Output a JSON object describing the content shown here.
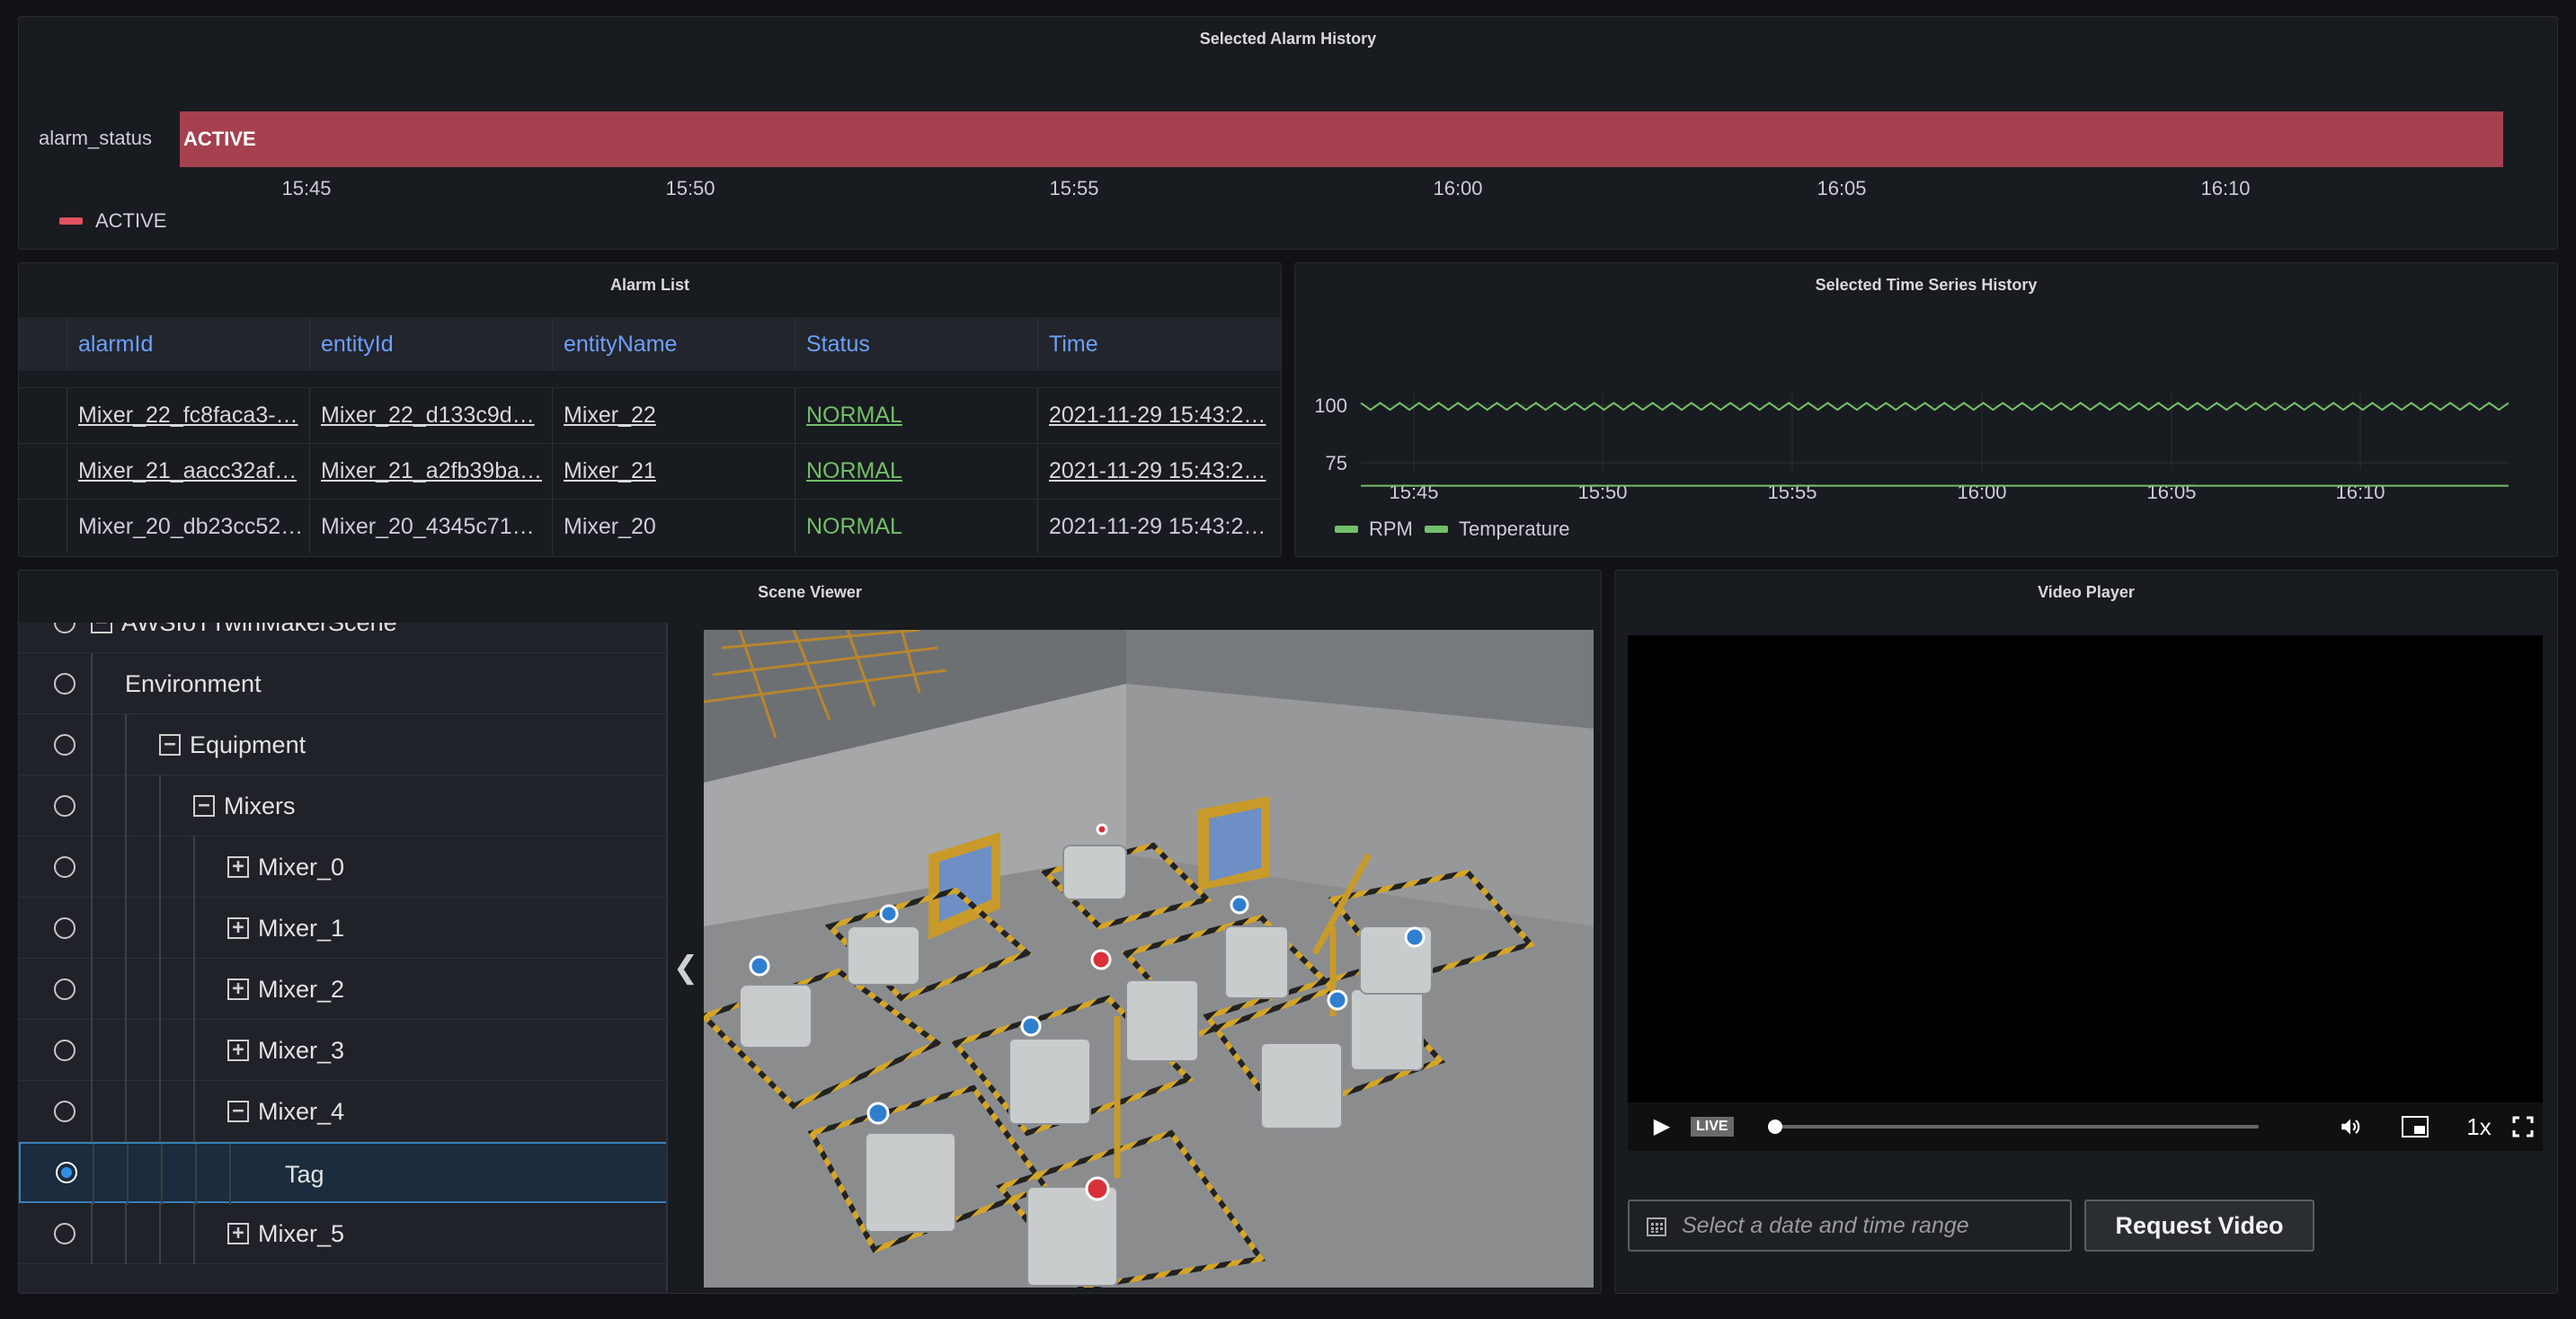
{
  "colors": {
    "panel_bg": "#181b1f",
    "alarm_active": "#a5414e",
    "series_green": "#73bf69",
    "header_blue": "#6e9fff",
    "selection_blue": "#2f8fe5"
  },
  "alarm_history": {
    "title": "Selected Alarm History",
    "row_label": "alarm_status",
    "bar_label": "ACTIVE",
    "ticks": [
      "15:45",
      "15:50",
      "15:55",
      "16:00",
      "16:05",
      "16:10"
    ],
    "legend": "ACTIVE"
  },
  "alarm_list": {
    "title": "Alarm List",
    "columns": [
      "alarmId",
      "entityId",
      "entityName",
      "Status",
      "Time"
    ],
    "rows": [
      [
        "Mixer_22_fc8faca3-…",
        "Mixer_22_d133c9d…",
        "Mixer_22",
        "NORMAL",
        "2021-11-29 15:43:2…"
      ],
      [
        "Mixer_21_aacc32af…",
        "Mixer_21_a2fb39ba…",
        "Mixer_21",
        "NORMAL",
        "2021-11-29 15:43:2…"
      ],
      [
        "Mixer_20_db23cc52…",
        "Mixer_20_4345c71…",
        "Mixer_20",
        "NORMAL",
        "2021-11-29 15:43:2…"
      ]
    ]
  },
  "time_series": {
    "title": "Selected Time Series History"
  },
  "chart_data": {
    "type": "line",
    "title": "Selected Time Series History",
    "xlabel": "",
    "ylabel": "",
    "x_ticks": [
      "15:45",
      "15:50",
      "15:55",
      "16:00",
      "16:05",
      "16:10"
    ],
    "y_ticks": [
      100,
      75
    ],
    "ylim": [
      60,
      105
    ],
    "grid": true,
    "legend_position": "bottom-left",
    "series": [
      {
        "name": "RPM",
        "color": "#73bf69",
        "pattern": "oscillating",
        "low": 98,
        "high": 101
      },
      {
        "name": "Temperature",
        "color": "#73bf69",
        "pattern": "flat",
        "value": 65
      }
    ]
  },
  "scene_viewer": {
    "title": "Scene Viewer",
    "tree": [
      {
        "label": "AWSIoTTwinMakerScene",
        "expander": "−",
        "selected": false
      },
      {
        "label": "Environment",
        "expander": "",
        "selected": false
      },
      {
        "label": "Equipment",
        "expander": "−",
        "selected": false
      },
      {
        "label": "Mixers",
        "expander": "−",
        "selected": false
      },
      {
        "label": "Mixer_0",
        "expander": "+",
        "selected": false
      },
      {
        "label": "Mixer_1",
        "expander": "+",
        "selected": false
      },
      {
        "label": "Mixer_2",
        "expander": "+",
        "selected": false
      },
      {
        "label": "Mixer_3",
        "expander": "+",
        "selected": false
      },
      {
        "label": "Mixer_4",
        "expander": "−",
        "selected": false
      },
      {
        "label": "Tag",
        "expander": "",
        "selected": true
      },
      {
        "label": "Mixer_5",
        "expander": "+",
        "selected": false
      }
    ],
    "collapse_icon": "chevron-left-icon"
  },
  "video_player": {
    "title": "Video Player",
    "live_label": "LIVE",
    "speed_label": "1x",
    "date_placeholder": "Select a date and time range",
    "request_button": "Request Video"
  }
}
